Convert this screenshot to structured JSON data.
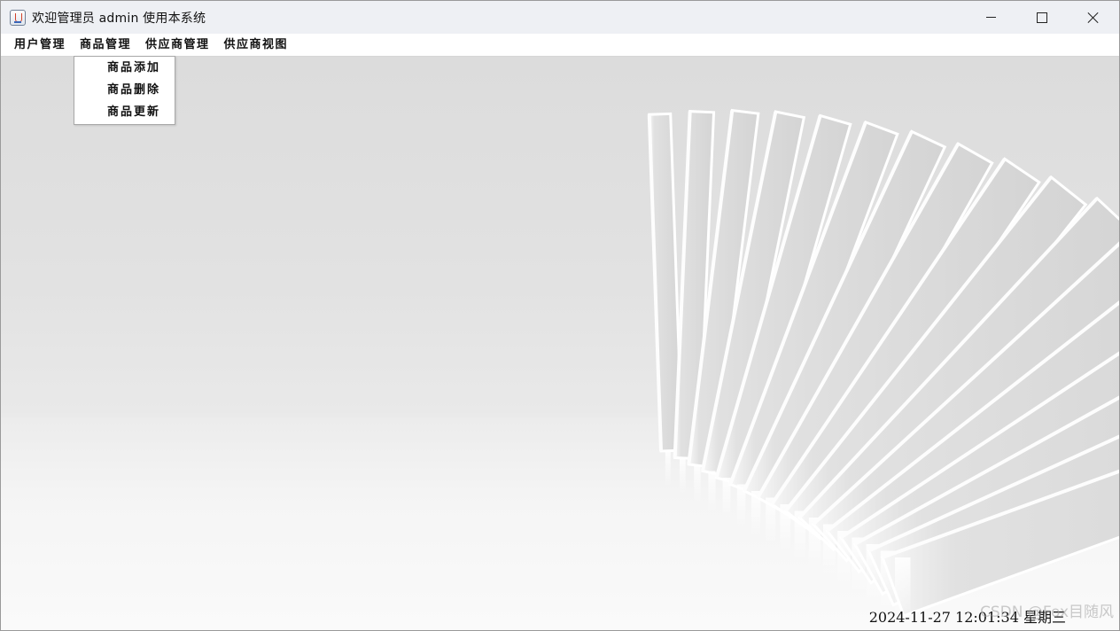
{
  "window": {
    "title": "欢迎管理员 admin 使用本系统",
    "icon": "java-app-icon"
  },
  "menubar": {
    "items": [
      "用户管理",
      "商品管理",
      "供应商管理",
      "供应商视图"
    ]
  },
  "dropdown": {
    "items": [
      "商品添加",
      "商品删除",
      "商品更新"
    ]
  },
  "status": {
    "datetime": "2024-11-27 12:01:34 星期三"
  },
  "watermark": {
    "text": "CSDN @Fox目随风"
  },
  "colors": {
    "titlebar": "#eef0f4",
    "menubar": "#ffffff",
    "background": "#e2e2e2"
  }
}
